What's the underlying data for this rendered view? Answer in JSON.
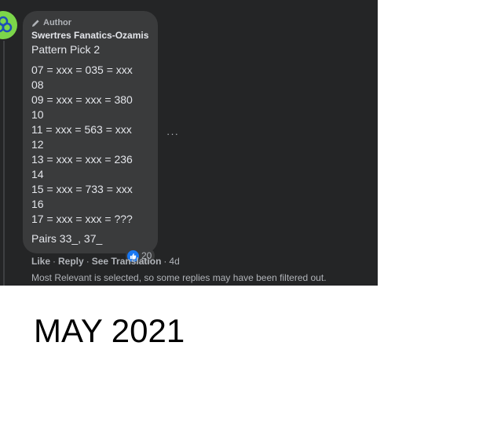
{
  "colors": {
    "panel_bg": "#242526",
    "bubble_bg": "#3a3b3c",
    "primary_text": "#e4e6eb",
    "secondary_text": "#b0b3b8",
    "avatar_green": "#7cd64a",
    "like_blue": "#1877f2"
  },
  "comment": {
    "badge": "Author",
    "author": "Swertres Fanatics-Ozamis",
    "title": "Pattern Pick 2",
    "lines": [
      "07 = xxx = 035 = xxx",
      "08",
      "09 = xxx = xxx = 380",
      "10",
      "11 = xxx = 563 = xxx",
      "12",
      "13 = xxx = xxx = 236",
      "14",
      "15 = xxx = 733 = xxx",
      "16",
      "17 = xxx = xxx = ???"
    ],
    "pairs": "Pairs 33_, 37_",
    "reaction_count": "20",
    "more_label": "···"
  },
  "actions": {
    "like": "Like",
    "reply": "Reply",
    "translate": "See Translation",
    "separator": "·",
    "time": "4d"
  },
  "filter_note": "Most Relevant is selected, so some replies may have been filtered out.",
  "caption": "MAY 2021"
}
